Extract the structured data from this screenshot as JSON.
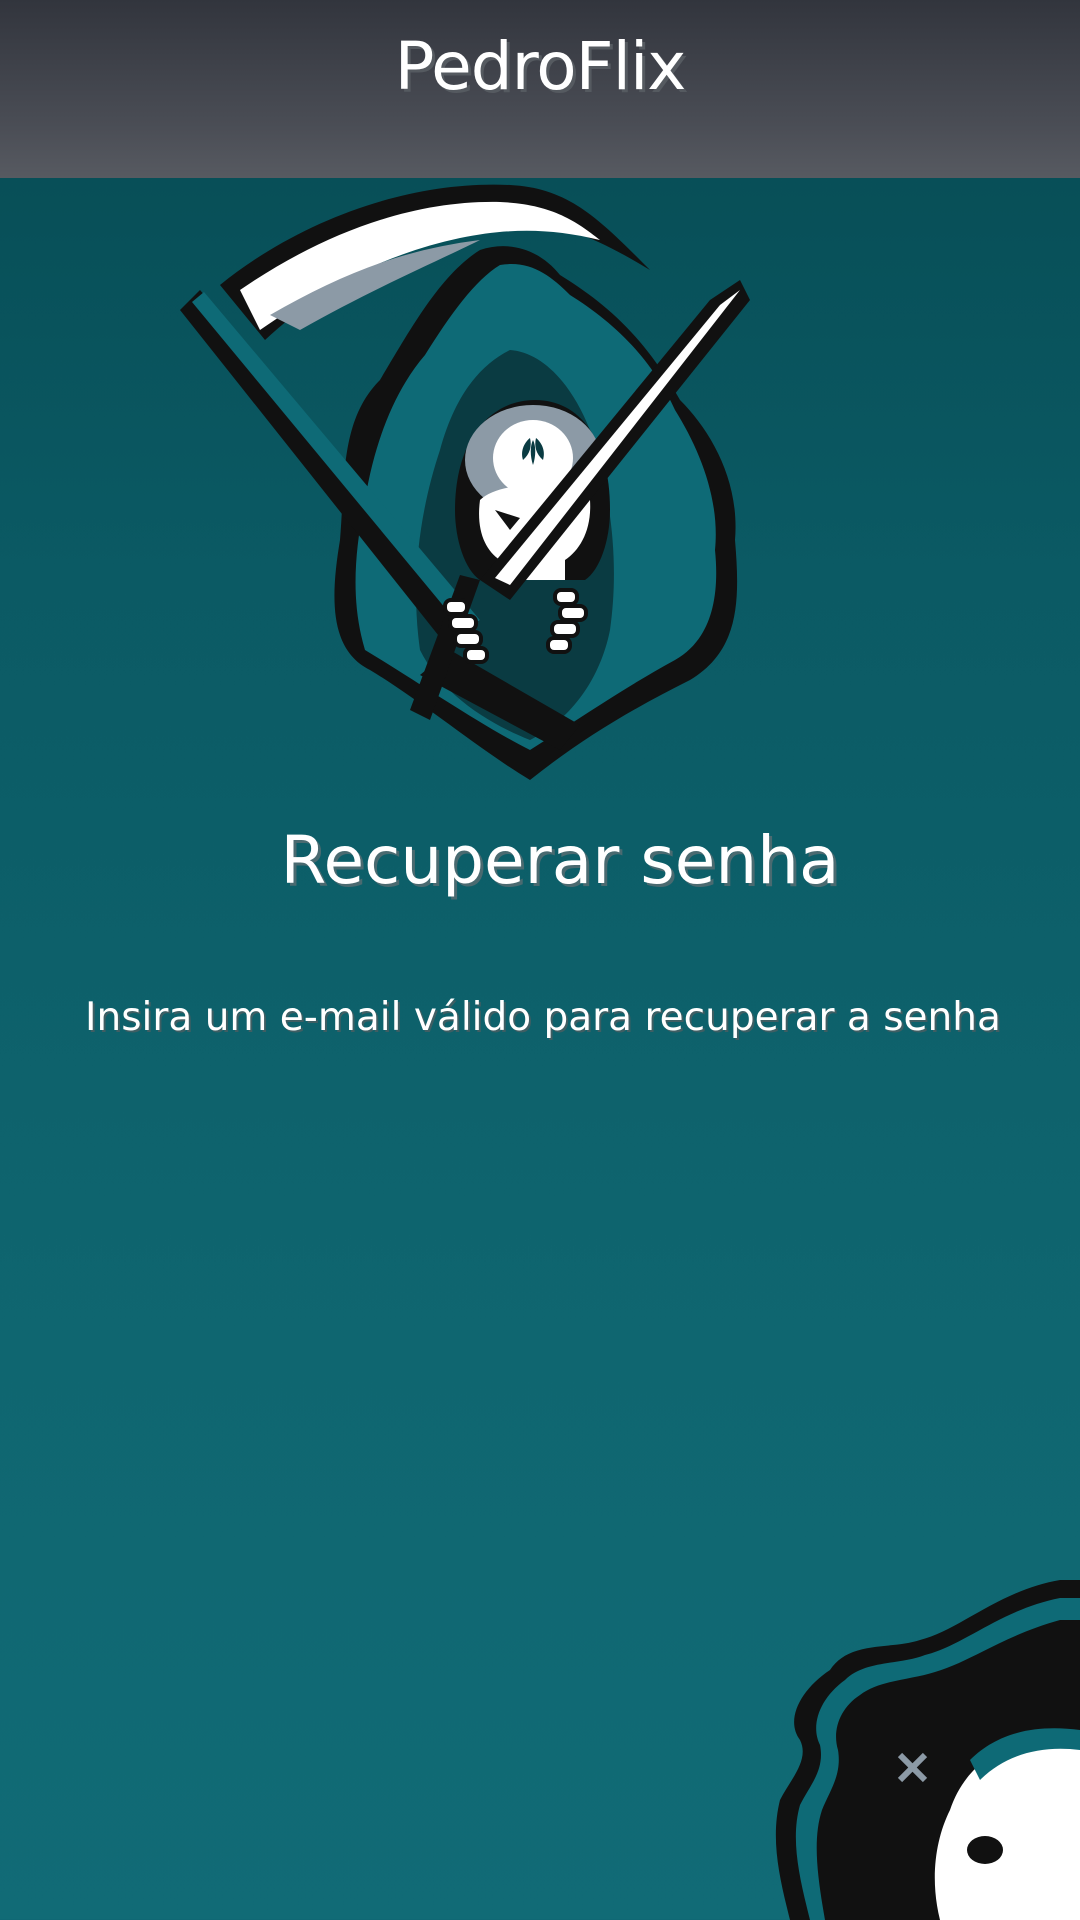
{
  "header": {
    "app_title": "PedroFlix"
  },
  "main": {
    "logo_icon": "grim-reaper-mascot-icon",
    "title": "Recuperar senha",
    "instructions": "Insira um e-mail válido para recuperar a senha"
  },
  "decor": {
    "corner_icon": "pirate-skull-icon"
  },
  "colors": {
    "header_top": "#32353d",
    "header_bottom": "#575a61",
    "background_top": "#064a52",
    "background_bottom": "#116b76",
    "text": "#ffffff"
  }
}
